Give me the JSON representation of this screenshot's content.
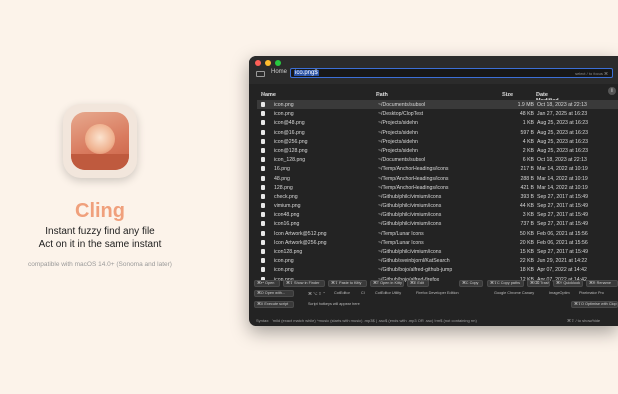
{
  "promo": {
    "app_name": "Cling",
    "tagline1": "Instant fuzzy find any file",
    "tagline2": "Act on it in the same instant",
    "compat": "compatible with macOS 14.0+ (Sonoma and later)"
  },
  "window": {
    "breadcrumb": "Home",
    "search_value": "ico.png$",
    "search_hint": "select / to focus ⌘",
    "columns": {
      "name": "Name",
      "path": "Path",
      "size": "Size",
      "date": "Date Modified"
    },
    "rows": [
      {
        "name": "icon.png",
        "path": "~/Documents/subsol",
        "size": "1.9 MB",
        "date": "Oct 18, 2023 at 22:13"
      },
      {
        "name": "icon.png",
        "path": "~/Desktop/ClopTest",
        "size": "48 KB",
        "date": "Jan 27, 2025 at 16:23"
      },
      {
        "name": "icon@48.png",
        "path": "~/Projects/sidehn",
        "size": "1 KB",
        "date": "Aug 25, 2023 at 16:23"
      },
      {
        "name": "icon@16.png",
        "path": "~/Projects/sidehn",
        "size": "597 B",
        "date": "Aug 25, 2023 at 16:23"
      },
      {
        "name": "icon@256.png",
        "path": "~/Projects/sidehn",
        "size": "4 KB",
        "date": "Aug 25, 2023 at 16:23"
      },
      {
        "name": "icon@128.png",
        "path": "~/Projects/sidehn",
        "size": "2 KB",
        "date": "Aug 25, 2023 at 16:23"
      },
      {
        "name": "icon_128.png",
        "path": "~/Documents/subsol",
        "size": "6 KB",
        "date": "Oct 18, 2023 at 22:13"
      },
      {
        "name": "16.png",
        "path": "~/Temp/AnchorHeadings/icons",
        "size": "217 B",
        "date": "Mar 14, 2022 at 10:19"
      },
      {
        "name": "48.png",
        "path": "~/Temp/AnchorHeadings/icons",
        "size": "288 B",
        "date": "Mar 14, 2022 at 10:19"
      },
      {
        "name": "128.png",
        "path": "~/Temp/AnchorHeadings/icons",
        "size": "421 B",
        "date": "Mar 14, 2022 at 10:19"
      },
      {
        "name": "check.png",
        "path": "~/Github/philc/vimium/icons",
        "size": "393 B",
        "date": "Sep 27, 2017 at 15:49"
      },
      {
        "name": "vimium.png",
        "path": "~/Github/philc/vimium/icons",
        "size": "44 KB",
        "date": "Sep 27, 2017 at 15:49"
      },
      {
        "name": "icon48.png",
        "path": "~/Github/philc/vimium/icons",
        "size": "3 KB",
        "date": "Sep 27, 2017 at 15:49"
      },
      {
        "name": "icon16.png",
        "path": "~/Github/philc/vimium/icons",
        "size": "737 B",
        "date": "Sep 27, 2017 at 15:49"
      },
      {
        "name": "Icon Artwork@512.png",
        "path": "~/Temp/Lunar Icons",
        "size": "50 KB",
        "date": "Feb 06, 2021 at 15:56"
      },
      {
        "name": "Icon Artwork@256.png",
        "path": "~/Temp/Lunar Icons",
        "size": "20 KB",
        "date": "Feb 06, 2021 at 15:56"
      },
      {
        "name": "icon128.png",
        "path": "~/Github/philc/vimium/icons",
        "size": "15 KB",
        "date": "Sep 27, 2017 at 15:49"
      },
      {
        "name": "icon.png",
        "path": "~/Github/sveinbjornl/KatSearch",
        "size": "22 KB",
        "date": "Jun 29, 2021 at 14:22"
      },
      {
        "name": "icon.png",
        "path": "~/Github/bojo/alfred-github-jump",
        "size": "18 KB",
        "date": "Apr 07, 2022 at 14:42"
      },
      {
        "name": "icon.png",
        "path": "~/Github/bojo/alfred-firefox",
        "size": "12 KB",
        "date": "Apr 07, 2022 at 14:42"
      }
    ],
    "actions_row1": [
      "⌘↩ Open",
      "⌘⇧ Show in Finder",
      "⌘⇧ Paste to Kitty",
      "⌘T Open in Kitty",
      "⌘E Edit",
      "⌘C Copy",
      "⌘⇧C Copy paths",
      "⌘⌫ Trash",
      "⌘Y Quicklook",
      "⌘R Rename"
    ],
    "actions_row2_btn": "⌘O Open with...",
    "actions_row2_plain": [
      "⌘ ⌥ ⇧ ⌃",
      "CotEditor",
      "Cl",
      "CotEditor Utility",
      "Firefox Developer Edition",
      "Google Chrome Canary",
      "ImageOptim",
      "Pixelmator Pro"
    ],
    "actions_row3_btn1": "⌘X Execute script",
    "actions_row3_plain": "Script hotkeys will appear here",
    "actions_row3_btn2": "⌘⇧O Optimise with Clop",
    "footer": {
      "syntax_label": "Syntax:",
      "syntax_text": "'mild (exact match while) ^music (starts with music) .mp3$ | .ssc$ (ends with .mp3 OR .ssc) !rm$ (not containing rm)",
      "toggle": "⌘⇧ / to show/hide"
    }
  }
}
